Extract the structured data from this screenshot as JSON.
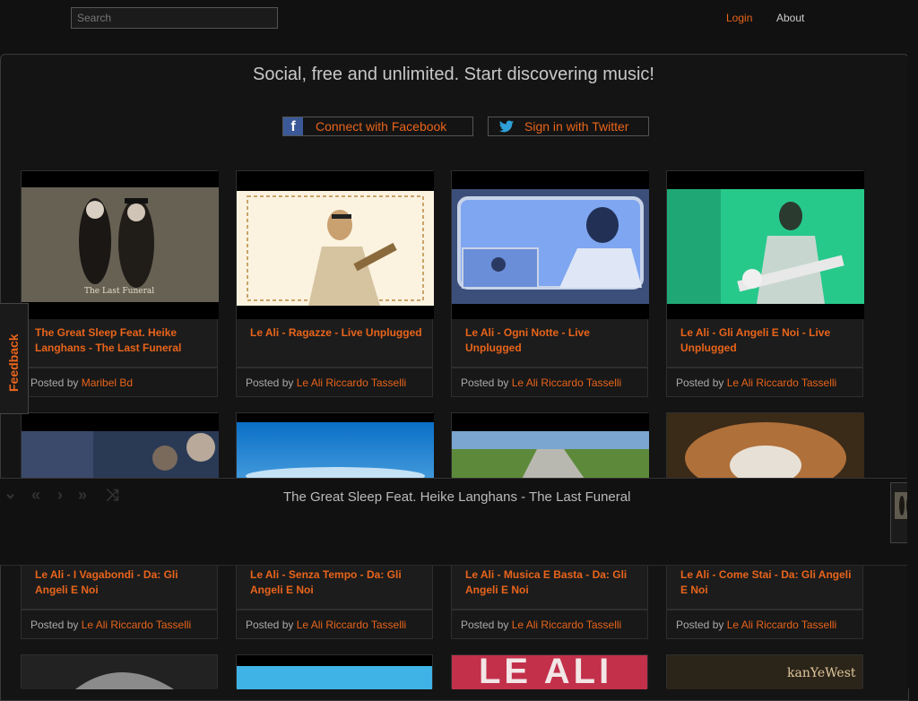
{
  "header": {
    "search_placeholder": "Search",
    "login_label": "Login",
    "about_label": "About"
  },
  "hero": {
    "headline": "Social, free and unlimited. Start discovering music!",
    "facebook_label": "Connect with Facebook",
    "twitter_label": "Sign in with Twitter",
    "facebook_icon": "f"
  },
  "posted_by_label": "Posted by",
  "videos": [
    {
      "title": "The Great Sleep Feat. Heike Langhans - The Last Funeral",
      "poster": "Maribel Bd",
      "thumb_caption": "The Last Funeral"
    },
    {
      "title": "Le Ali - Ragazze - Live Unplugged",
      "poster": "Le Ali Riccardo Tasselli"
    },
    {
      "title": "Le Ali - Ogni Notte - Live Unplugged",
      "poster": "Le Ali Riccardo Tasselli"
    },
    {
      "title": "Le Ali - Gli Angeli E Noi - Live Unplugged",
      "poster": "Le Ali Riccardo Tasselli"
    },
    {
      "title": "Le Ali - I Vagabondi - Da: Gli Angeli E Noi",
      "poster": "Le Ali Riccardo Tasselli"
    },
    {
      "title": "Le Ali - Senza Tempo - Da: Gli Angeli E Noi",
      "poster": "Le Ali Riccardo Tasselli"
    },
    {
      "title": "Le Ali - Musica E Basta - Da: Gli Angeli E Noi",
      "poster": "Le Ali Riccardo Tasselli"
    },
    {
      "title": "Le Ali - Come Stai - Da: Gli Angeli E Noi",
      "poster": "Le Ali Riccardo Tasselli"
    }
  ],
  "bottom_thumbs": [
    {
      "caption": "LE ALI"
    },
    {
      "caption": "kanYeWest"
    }
  ],
  "feedback_label": "Feedback",
  "player": {
    "now_playing": "The Great Sleep Feat. Heike Langhans - The Last Funeral",
    "controls": [
      "collapse-icon",
      "previous-icon",
      "play-icon",
      "next-icon",
      "shuffle-icon"
    ]
  },
  "colors": {
    "accent": "#e8641b",
    "background": "#111111",
    "facebook": "#3b5998",
    "twitter": "#2f9fd8"
  }
}
